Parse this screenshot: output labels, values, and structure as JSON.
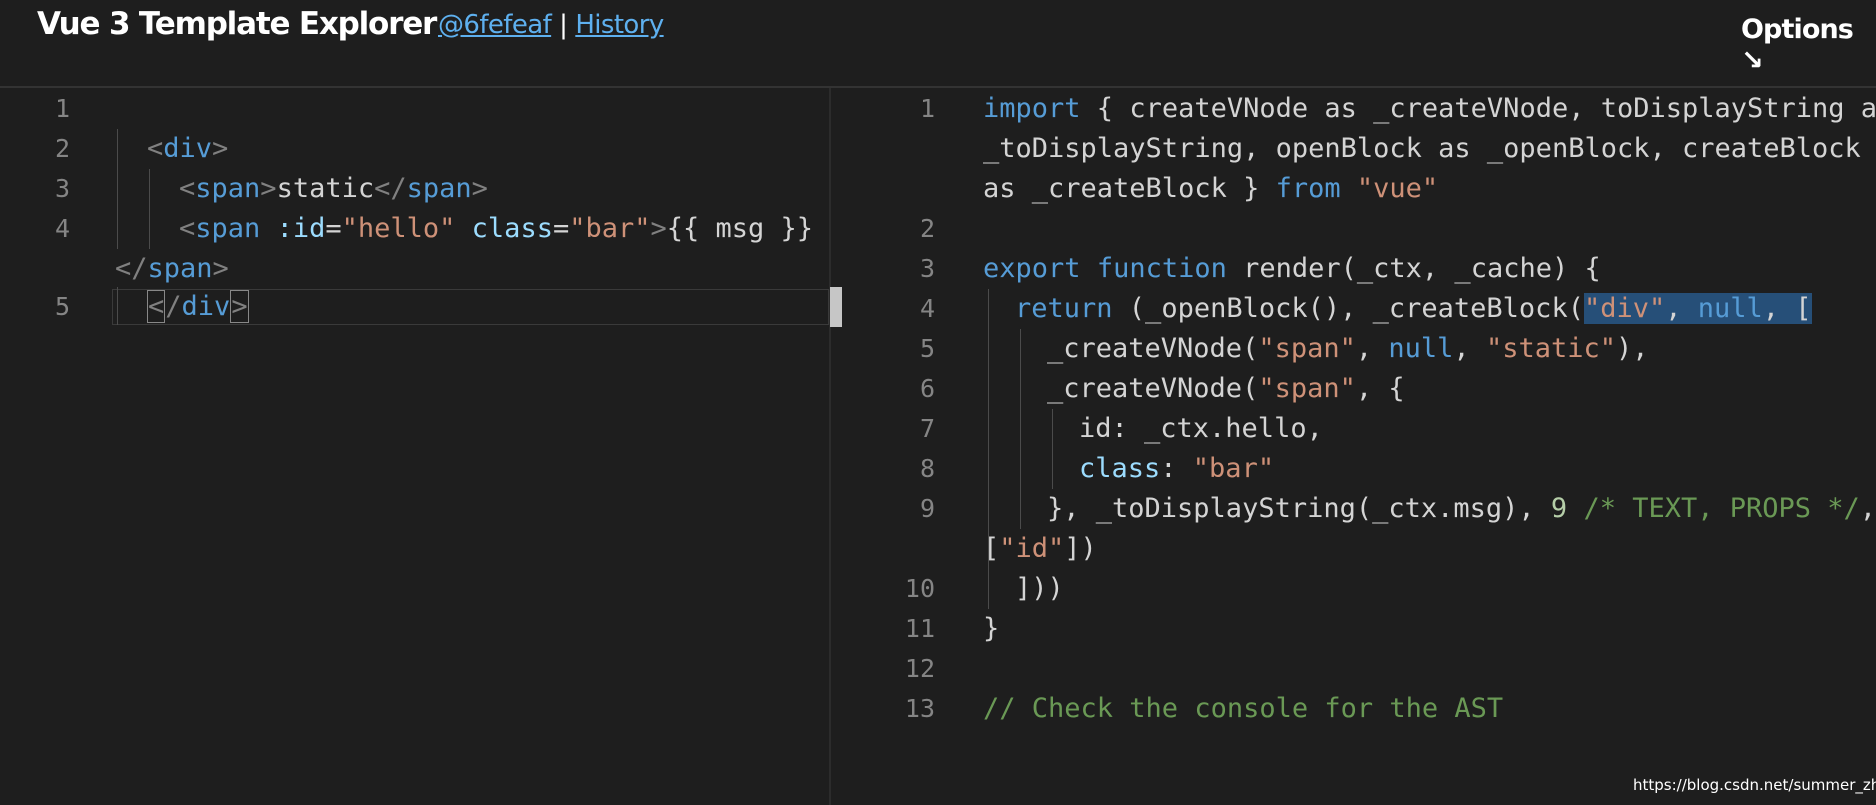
{
  "header": {
    "title": "Vue 3 Template Explorer",
    "commit_link": "@6fefeaf",
    "separator": "|",
    "history_link": "History",
    "options_label": "Options ↘"
  },
  "editor_left": {
    "line_numbers": [
      "1",
      "2",
      "3",
      "4",
      "5"
    ],
    "code": {
      "l2_open": "<",
      "l2_tag": "div",
      "l2_close": ">",
      "l3_open": "<",
      "l3_tag": "span",
      "l3_close": ">",
      "l3_text": "static",
      "l3_end_open": "</",
      "l3_end_tag": "span",
      "l3_end_close": ">",
      "l4_open": "<",
      "l4_tag": "span",
      "l4_attr1": ":id",
      "l4_eq1": "=",
      "l4_val1": "\"hello\"",
      "l4_attr2": "class",
      "l4_eq2": "=",
      "l4_val2": "\"bar\"",
      "l4_close": ">",
      "l4_text": "{{ msg }}",
      "l4_wrap_open": "</",
      "l4_wrap_tag": "span",
      "l4_wrap_close": ">",
      "l5_open": "<",
      "l5_slash": "/",
      "l5_tag": "div",
      "l5_close": ">"
    }
  },
  "editor_right": {
    "line_numbers": [
      "1",
      "2",
      "3",
      "4",
      "5",
      "6",
      "7",
      "8",
      "9",
      "10",
      "11",
      "12",
      "13"
    ],
    "code": {
      "l1_kw": "import",
      "l1_a": " { createVNode as _createVNode, toDisplayString as",
      "l1_b": "_toDisplayString, openBlock as _openBlock, createBlock",
      "l1_c": "as _createBlock } ",
      "l1_from": "from",
      "l1_src": "\"vue\"",
      "l3_kw1": "export",
      "l3_kw2": "function",
      "l3_rest": " render(_ctx, _cache) {",
      "l4_kw": "return",
      "l4_a": " (_openBlock(), _createBlock(",
      "l4_str": "\"div\"",
      "l4_comma": ", ",
      "l4_null": "null",
      "l4_end": ", [",
      "l5_a": "_createVNode(",
      "l5_s1": "\"span\"",
      "l5_c": ", ",
      "l5_null": "null",
      "l5_c2": ", ",
      "l5_s2": "\"static\"",
      "l5_end": "),",
      "l6_a": "_createVNode(",
      "l6_s1": "\"span\"",
      "l6_end": ", {",
      "l7_a": "id: _ctx.hello,",
      "l8_key": "class",
      "l8_colon": ": ",
      "l8_val": "\"bar\"",
      "l9_a": "}, _toDisplayString(_ctx.msg), ",
      "l9_num": "9",
      "l9_cm": " /* TEXT, PROPS */",
      "l9_end": ",",
      "l9w_open": "[",
      "l9w_str": "\"id\"",
      "l9w_end": "])",
      "l10": "]))",
      "l11": "}",
      "l13_cm": "// Check the console for the AST"
    }
  },
  "watermark": "https://blog.csdn.net/summer_zhh",
  "colors": {
    "background": "#1e1e1e",
    "keyword": "#569cd6",
    "string": "#ce9178",
    "attribute": "#9cdcfe",
    "comment": "#6a9955",
    "number": "#b5cea8",
    "link": "#5eb0ef",
    "selection": "#264f78"
  }
}
